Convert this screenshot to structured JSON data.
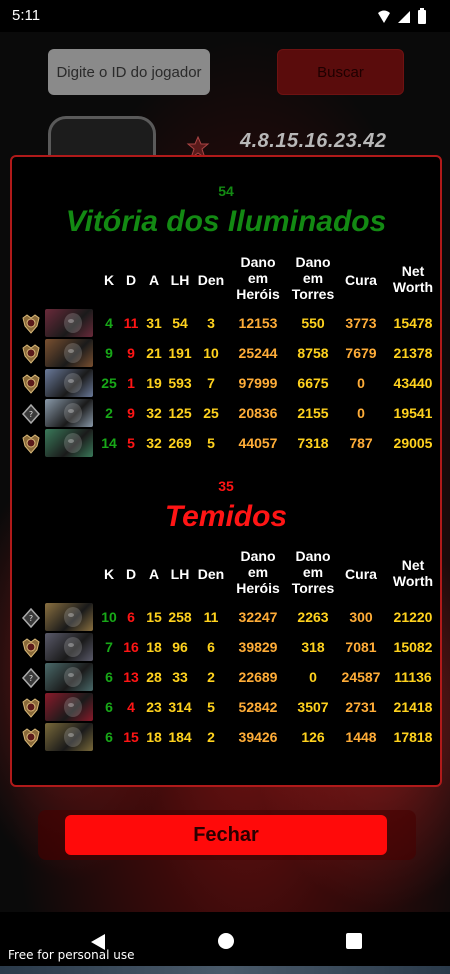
{
  "status_bar": {
    "time": "5:11"
  },
  "search": {
    "placeholder": "Digite o ID do jogador",
    "button_label": "Buscar"
  },
  "header_code": "4.8.15.16.23.42",
  "modal": {
    "columns": {
      "k": "K",
      "d": "D",
      "a": "A",
      "lh": "LH",
      "den": "Den",
      "hero_damage": [
        "Dano",
        "em",
        "Heróis"
      ],
      "tower_damage": [
        "Dano",
        "em",
        "Torres"
      ],
      "heal": "Cura",
      "net_worth": [
        "Net",
        "Worth"
      ]
    },
    "teams": [
      {
        "score": "54",
        "title": "Vitória dos Iluminados",
        "color": "#138a13",
        "players": [
          {
            "rank_icon": "rank-medal-icon",
            "hero_color": "#6a2a3a",
            "k": "4",
            "d": "11",
            "a": "31",
            "lh": "54",
            "den": "3",
            "hero_damage": "12153",
            "tower_damage": "550",
            "heal": "3773",
            "net_worth": "15478"
          },
          {
            "rank_icon": "rank-medal-icon",
            "hero_color": "#7a5030",
            "k": "9",
            "d": "9",
            "a": "21",
            "lh": "191",
            "den": "10",
            "hero_damage": "25244",
            "tower_damage": "8758",
            "heal": "7679",
            "net_worth": "21378"
          },
          {
            "rank_icon": "rank-medal-icon",
            "hero_color": "#6a7a9a",
            "k": "25",
            "d": "1",
            "a": "19",
            "lh": "593",
            "den": "7",
            "hero_damage": "97999",
            "tower_damage": "6675",
            "heal": "0",
            "net_worth": "43440"
          },
          {
            "rank_icon": "uncalibrated-rank-icon",
            "hero_color": "#8a9aaa",
            "k": "2",
            "d": "9",
            "a": "32",
            "lh": "125",
            "den": "25",
            "hero_damage": "20836",
            "tower_damage": "2155",
            "heal": "0",
            "net_worth": "19541"
          },
          {
            "rank_icon": "rank-medal-icon",
            "hero_color": "#3a7a5a",
            "k": "14",
            "d": "5",
            "a": "32",
            "lh": "269",
            "den": "5",
            "hero_damage": "44057",
            "tower_damage": "7318",
            "heal": "787",
            "net_worth": "29005"
          }
        ]
      },
      {
        "score": "35",
        "title": "Temidos",
        "color": "#ff1515",
        "players": [
          {
            "rank_icon": "uncalibrated-rank-icon",
            "hero_color": "#8a7040",
            "k": "10",
            "d": "6",
            "a": "15",
            "lh": "258",
            "den": "11",
            "hero_damage": "32247",
            "tower_damage": "2263",
            "heal": "300",
            "net_worth": "21220"
          },
          {
            "rank_icon": "rank-medal-icon",
            "hero_color": "#5a5a6a",
            "k": "7",
            "d": "16",
            "a": "18",
            "lh": "96",
            "den": "6",
            "hero_damage": "39829",
            "tower_damage": "318",
            "heal": "7081",
            "net_worth": "15082"
          },
          {
            "rank_icon": "uncalibrated-rank-icon",
            "hero_color": "#4a6a6a",
            "k": "6",
            "d": "13",
            "a": "28",
            "lh": "33",
            "den": "2",
            "hero_damage": "22689",
            "tower_damage": "0",
            "heal": "24587",
            "net_worth": "11136"
          },
          {
            "rank_icon": "rank-medal-icon",
            "hero_color": "#8a1a2a",
            "k": "6",
            "d": "4",
            "a": "23",
            "lh": "314",
            "den": "5",
            "hero_damage": "52842",
            "tower_damage": "3507",
            "heal": "2731",
            "net_worth": "21418"
          },
          {
            "rank_icon": "rank-medal-icon",
            "hero_color": "#7a6a3a",
            "k": "6",
            "d": "15",
            "a": "18",
            "lh": "184",
            "den": "2",
            "hero_damage": "39426",
            "tower_damage": "126",
            "heal": "1448",
            "net_worth": "17818"
          }
        ]
      }
    ]
  },
  "close_button_label": "Fechar",
  "watermark": "Free for personal use",
  "colors": {
    "kills": "#18a818",
    "deaths": "#ff1515",
    "assists": "#ffd21e",
    "damage": "#ffad38",
    "modal_border": "#b01a1a",
    "close_button": "#ff0a0a"
  }
}
